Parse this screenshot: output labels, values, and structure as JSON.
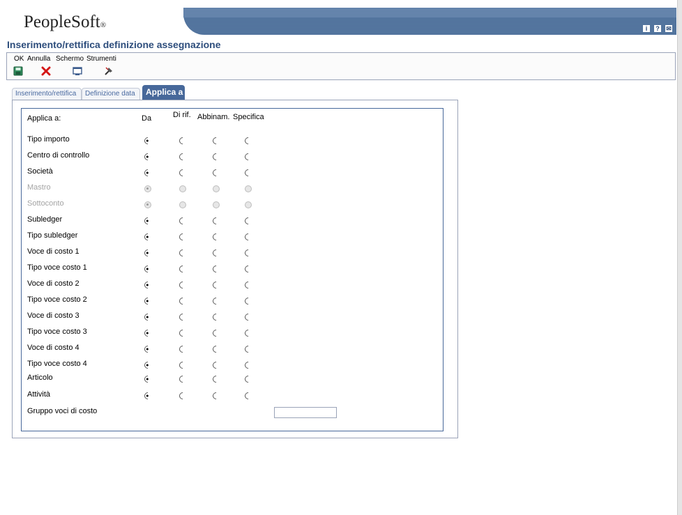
{
  "app": {
    "logo_text": "PeopleSoft",
    "logo_mark": "®",
    "title": "Inserimento/rettifica definizione assegnazione"
  },
  "header_icons": [
    {
      "icon": "info-icon",
      "glyph": "i"
    },
    {
      "icon": "help-icon",
      "glyph": "?"
    },
    {
      "icon": "email-icon",
      "glyph": "✉"
    }
  ],
  "toolbar": {
    "ok_label": "OK",
    "cancel_label": "Annulla",
    "screen_label": "Schermo",
    "tools_label": "Strumenti"
  },
  "tabs": [
    {
      "label": "Inserimento/rettifica",
      "active": false
    },
    {
      "label": "Definizione data",
      "active": false
    },
    {
      "label": "Applica a",
      "active": true
    }
  ],
  "grid": {
    "header_label": "Applica a:",
    "col_da": "Da",
    "col_dirif": "Di rif.",
    "col_abbinam": "Abbinam.",
    "col_specifica": "Specifica",
    "rows": [
      {
        "label": "Tipo importo",
        "selected": "da",
        "disabled": false
      },
      {
        "label": "Centro di controllo",
        "selected": "da",
        "disabled": false
      },
      {
        "label": "Società",
        "selected": "da",
        "disabled": false
      },
      {
        "label": "Mastro",
        "selected": "da",
        "disabled": true
      },
      {
        "label": "Sottoconto",
        "selected": "da",
        "disabled": true
      },
      {
        "label": "Subledger",
        "selected": "da",
        "disabled": false
      },
      {
        "label": "Tipo subledger",
        "selected": "da",
        "disabled": false
      },
      {
        "label": "Voce di costo 1",
        "selected": "da",
        "disabled": false
      },
      {
        "label": "Tipo voce costo 1",
        "selected": "da",
        "disabled": false
      },
      {
        "label": "Voce di costo 2",
        "selected": "da",
        "disabled": false
      },
      {
        "label": "Tipo voce costo 2",
        "selected": "da",
        "disabled": false
      },
      {
        "label": "Voce di costo 3",
        "selected": "da",
        "disabled": false
      },
      {
        "label": "Tipo voce costo 3",
        "selected": "da",
        "disabled": false
      },
      {
        "label": "Voce di costo 4",
        "selected": "da",
        "disabled": false
      },
      {
        "label": "Tipo voce costo 4",
        "selected": "da",
        "disabled": false
      },
      {
        "label": "Articolo",
        "selected": "da",
        "disabled": false
      },
      {
        "label": "Attività",
        "selected": "da",
        "disabled": false
      }
    ],
    "cost_group_label": "Gruppo voci di costo",
    "cost_group_value": ""
  }
}
